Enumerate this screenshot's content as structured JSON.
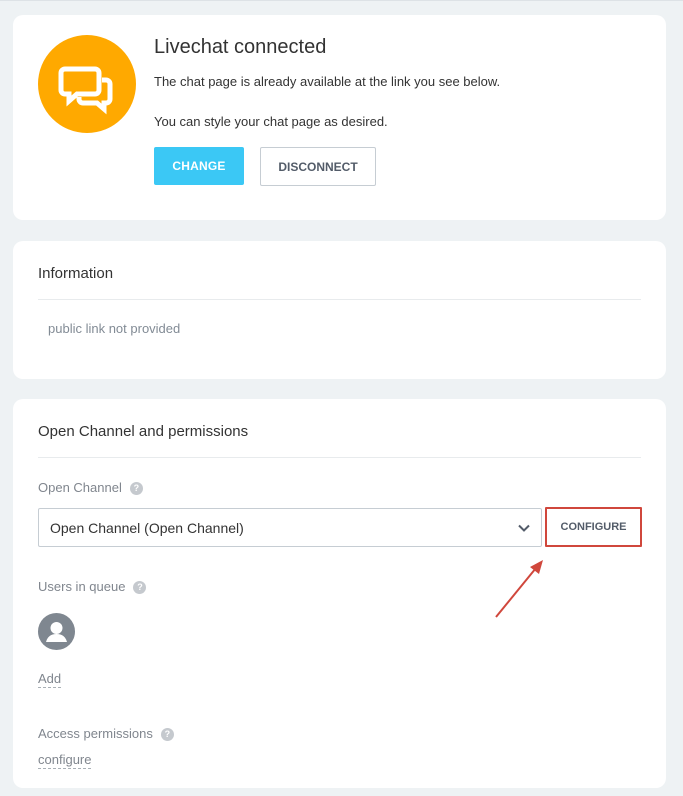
{
  "connected": {
    "title": "Livechat connected",
    "line1": "The chat page is already available at the link you see below.",
    "line2": "You can style your chat page as desired.",
    "change_label": "CHANGE",
    "disconnect_label": "DISCONNECT",
    "icon": "chat-bubbles-icon",
    "icon_color": "#ffa900"
  },
  "information": {
    "title": "Information",
    "text": "public link not provided"
  },
  "open_channel": {
    "title": "Open Channel and permissions",
    "channel_label": "Open Channel",
    "selected_value": "Open Channel (Open Channel)",
    "configure_label": "CONFIGURE",
    "users_label": "Users in queue",
    "add_label": "Add",
    "access_label": "Access permissions",
    "access_link": "configure",
    "help_glyph": "?"
  },
  "colors": {
    "accent": "#3bc8f5",
    "highlight": "#d0473c",
    "background": "#eef2f4"
  }
}
